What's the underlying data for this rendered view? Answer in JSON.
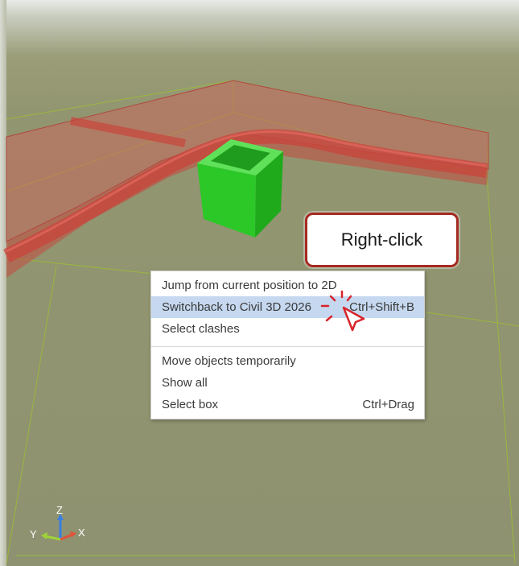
{
  "context_menu": {
    "items": [
      {
        "label": "Jump from current position to 2D",
        "shortcut": ""
      },
      {
        "label": "Switchback to Civil 3D 2026",
        "shortcut": "Ctrl+Shift+B"
      },
      {
        "label": "Select clashes",
        "shortcut": ""
      },
      {
        "label": "Move objects temporarily",
        "shortcut": ""
      },
      {
        "label": "Show all",
        "shortcut": ""
      },
      {
        "label": "Select box",
        "shortcut": "Ctrl+Drag"
      }
    ],
    "highlight_color": "#c5d8ef"
  },
  "callout": {
    "text": "Right-click"
  },
  "axis": {
    "z": "Z",
    "y": "Y",
    "x": "X"
  },
  "colors": {
    "background": "#8e9270",
    "pipe_red": "#c4524a",
    "box_green": "#2ec82a",
    "callout_border": "#a52a22"
  }
}
